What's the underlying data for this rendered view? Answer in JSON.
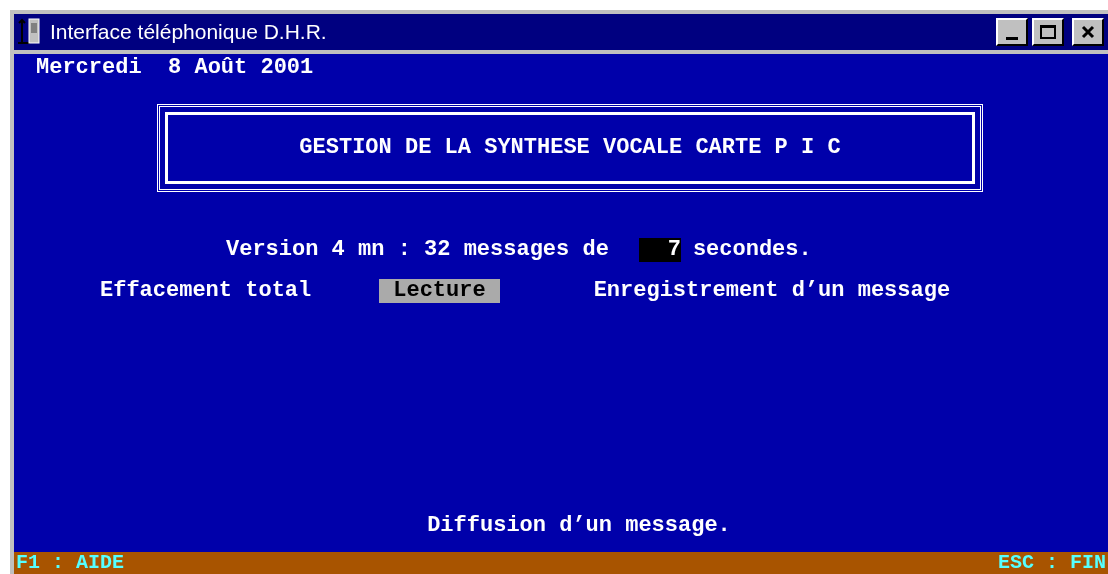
{
  "window": {
    "title": "Interface téléphonique D.H.R."
  },
  "date": "Mercredi  8 Août 2001",
  "heading": "GESTION DE LA SYNTHESE VOCALE CARTE P I C",
  "version": {
    "label": "Version 4 mn : 32 messages de",
    "value": "7",
    "unit": "secondes."
  },
  "options": [
    {
      "label": "Effacement total",
      "selected": false
    },
    {
      "label": "Lecture",
      "selected": true
    },
    {
      "label": "Enregistrement d’un message",
      "selected": false
    }
  ],
  "message": "Diffusion d’un message.",
  "status_bar": {
    "left": "F1 : AIDE",
    "right": "ESC : FIN"
  }
}
